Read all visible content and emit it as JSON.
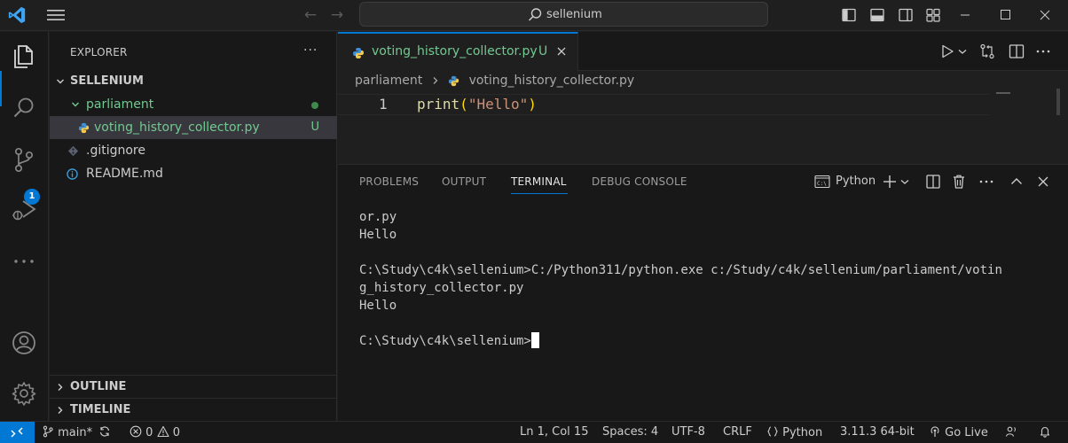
{
  "titlebar": {
    "search_text": "sellenium"
  },
  "activity": {
    "scm_badge": "1"
  },
  "explorer": {
    "title": "EXPLORER",
    "root_folder": "SELLENIUM",
    "tree": [
      {
        "label": "parliament",
        "kind": "folder",
        "color": "#73c991",
        "status": "dot"
      },
      {
        "label": "voting_history_collector.py",
        "kind": "python",
        "color": "#73c991",
        "status": "U"
      },
      {
        "label": ".gitignore",
        "kind": "gitignore",
        "color": "#cccccc",
        "status": ""
      },
      {
        "label": "README.md",
        "kind": "info",
        "color": "#cccccc",
        "status": ""
      }
    ],
    "outline_label": "OUTLINE",
    "timeline_label": "TIMELINE"
  },
  "editor": {
    "tab_label": "voting_history_collector.py",
    "tab_status": "U",
    "breadcrumb": [
      "parliament",
      "voting_history_collector.py"
    ],
    "line_number": "1",
    "code": {
      "fn": "print",
      "open": "(",
      "str": "\"Hello\"",
      "close": ")"
    }
  },
  "panel": {
    "tabs": [
      "PROBLEMS",
      "OUTPUT",
      "TERMINAL",
      "DEBUG CONSOLE"
    ],
    "active_tab": "TERMINAL",
    "shell_label": "Python",
    "terminal_lines": [
      "or.py",
      "Hello",
      "",
      "C:\\Study\\c4k\\sellenium>C:/Python311/python.exe c:/Study/c4k/sellenium/parliament/votin",
      "g_history_collector.py",
      "Hello",
      "",
      "C:\\Study\\c4k\\sellenium>"
    ]
  },
  "statusbar": {
    "branch": "main*",
    "errors": "0",
    "warnings": "0",
    "position": "Ln 1, Col 15",
    "spaces": "Spaces: 4",
    "encoding": "UTF-8",
    "eol": "CRLF",
    "language": "Python",
    "interpreter": "3.11.3 64-bit",
    "go_live": "Go Live"
  },
  "colors": {
    "accent": "#0078d4",
    "untracked": "#73c991"
  }
}
